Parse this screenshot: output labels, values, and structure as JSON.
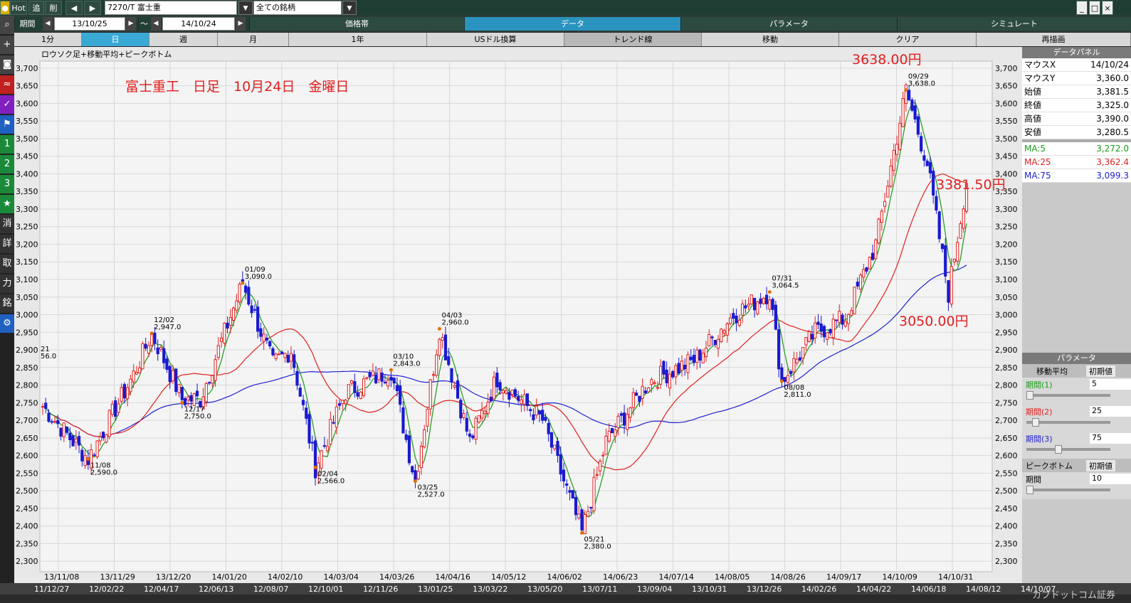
{
  "topbar": {
    "hot": "Hot",
    "btn1": "追",
    "btn2": "削",
    "symbol": "7270/T 富士重",
    "filter": "全ての銘柄"
  },
  "period": {
    "label": "期間",
    "from": "13/10/25",
    "sep": "～",
    "to": "14/10/24",
    "tabs": [
      "価格帯",
      "データ",
      "パラメータ",
      "シミュレート"
    ]
  },
  "bars": {
    "items": [
      "1分",
      "日",
      "週",
      "月",
      "1年",
      "USドル換算",
      "トレンド線",
      "移動",
      "クリア",
      "再描画"
    ],
    "active": "日"
  },
  "sidebar": {
    "items": [
      "search-icon",
      "cross-icon",
      "camera-icon",
      "chart-icon",
      "check-icon",
      "flag-icon",
      "1",
      "2",
      "3",
      "★",
      "消",
      "詳",
      "取",
      "力",
      "銘",
      "⚙"
    ]
  },
  "chart": {
    "subtitle": "ロウソク足+移動平均+ピークボトム",
    "headline": "富士重工　日足　10月24日　金曜日",
    "annotations": [
      {
        "text": "3638.00円",
        "color": "#e02020"
      },
      {
        "text": "3381.50円",
        "color": "#e02020"
      },
      {
        "text": "3050.00円",
        "color": "#e02020"
      }
    ],
    "left_stub": [
      "21",
      "56.0"
    ],
    "y_ticks": [
      "3,700",
      "3,650",
      "3,600",
      "3,550",
      "3,500",
      "3,450",
      "3,400",
      "3,350",
      "3,300",
      "3,250",
      "3,200",
      "3,150",
      "3,100",
      "3,050",
      "3,000",
      "2,950",
      "2,900",
      "2,850",
      "2,800",
      "2,750",
      "2,700",
      "2,650",
      "2,600",
      "2,550",
      "2,500",
      "2,450",
      "2,400",
      "2,350",
      "2,300"
    ],
    "x_ticks": [
      "13/11/08",
      "13/11/29",
      "13/12/20",
      "14/01/20",
      "14/02/10",
      "14/03/04",
      "14/03/26",
      "14/04/16",
      "14/05/12",
      "14/06/02",
      "14/06/23",
      "14/07/14",
      "14/08/05",
      "14/08/26",
      "14/09/17",
      "14/10/09",
      "14/10/31"
    ],
    "peaks": [
      {
        "date": "11/08",
        "value": "2,590.0",
        "price": 2590
      },
      {
        "date": "12/02",
        "value": "2,947.0",
        "price": 2947
      },
      {
        "date": "12/17",
        "value": "2,750.0",
        "price": 2750
      },
      {
        "date": "01/09",
        "value": "3,090.0",
        "price": 3090
      },
      {
        "date": "02/04",
        "value": "2,566.0",
        "price": 2566
      },
      {
        "date": "03/10",
        "value": "2,843.0",
        "price": 2843
      },
      {
        "date": "03/25",
        "value": "2,527.0",
        "price": 2527
      },
      {
        "date": "04/03",
        "value": "2,960.0",
        "price": 2960
      },
      {
        "date": "05/21",
        "value": "2,380.0",
        "price": 2380
      },
      {
        "date": "07/31",
        "value": "3,064.5",
        "price": 3064.5
      },
      {
        "date": "08/08",
        "value": "2,811.0",
        "price": 2811
      },
      {
        "date": "09/29",
        "value": "3,638.0",
        "price": 3638
      }
    ]
  },
  "bottom_axis": [
    "11/12/27",
    "12/02/22",
    "12/04/17",
    "12/06/13",
    "12/08/07",
    "12/10/01",
    "12/11/26",
    "13/01/25",
    "13/03/22",
    "13/05/20",
    "13/07/11",
    "13/09/04",
    "13/10/31",
    "13/12/26",
    "14/02/26",
    "14/04/22",
    "14/06/18",
    "14/08/12",
    "14/10/07"
  ],
  "watermark": "カブドットコム証券",
  "data_panel": {
    "title": "データパネル",
    "rows": [
      {
        "k": "マウスX",
        "v": "14/10/24"
      },
      {
        "k": "マウスY",
        "v": "3,360.0"
      },
      {
        "k": "始値",
        "v": "3,381.5"
      },
      {
        "k": "終値",
        "v": "3,325.0"
      },
      {
        "k": "高値",
        "v": "3,390.0"
      },
      {
        "k": "安値",
        "v": "3,280.5"
      }
    ],
    "ma": [
      {
        "k": "MA:5",
        "v": "3,272.0",
        "color": "#1a9a1a"
      },
      {
        "k": "MA:25",
        "v": "3,362.4",
        "color": "#e02020"
      },
      {
        "k": "MA:75",
        "v": "3,099.3",
        "color": "#2020d0"
      }
    ]
  },
  "params": {
    "title": "パラメータ",
    "ma_label": "移動平均",
    "init": "初期値",
    "p1_label": "期間(1)",
    "p1": "5",
    "p2_label": "期間(2)",
    "p2": "25",
    "p3_label": "期間(3)",
    "p3": "75",
    "pb_label": "ピークボトム",
    "pb_init": "初期値",
    "pb_period_label": "期間",
    "pb_period": "10"
  },
  "colors": {
    "up": "#e02020",
    "down": "#1a1ad0",
    "ma5": "#1a9a1a",
    "ma25": "#e02020",
    "ma75": "#2020d0",
    "peak": "#e07000"
  }
}
